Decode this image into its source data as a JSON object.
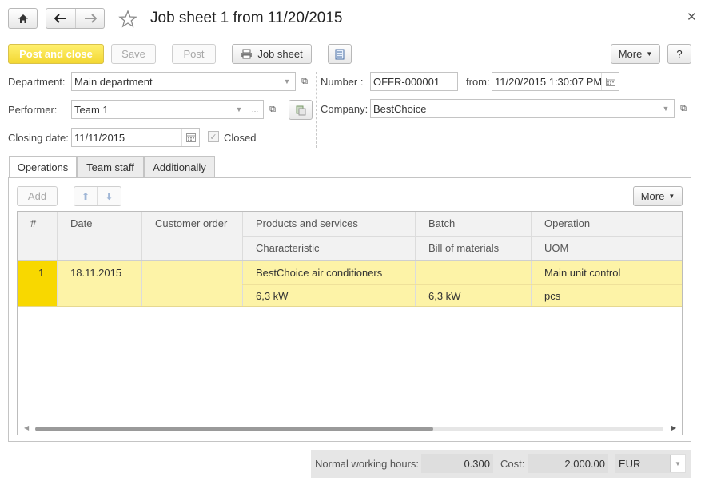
{
  "window": {
    "title": "Job sheet 1 from 11/20/2015"
  },
  "toolbar": {
    "post_close": "Post and close",
    "save": "Save",
    "post": "Post",
    "job_sheet": "Job sheet",
    "more": "More",
    "help": "?"
  },
  "form": {
    "department_label": "Department:",
    "department_value": "Main department",
    "performer_label": "Performer:",
    "performer_value": "Team 1",
    "closing_date_label": "Closing date:",
    "closing_date_value": "11/11/2015",
    "closed_label": "Closed",
    "number_label": "Number :",
    "number_value": "OFFR-000001",
    "from_label": "from:",
    "from_value": "11/20/2015  1:30:07 PM",
    "company_label": "Company:",
    "company_value": "BestChoice"
  },
  "tabs": [
    "Operations",
    "Team staff",
    "Additionally"
  ],
  "table_toolbar": {
    "add": "Add",
    "more": "More"
  },
  "table": {
    "headers": {
      "num": "#",
      "date": "Date",
      "customer_order": "Customer order",
      "products": "Products and services",
      "characteristic": "Characteristic",
      "batch": "Batch",
      "bom": "Bill of materials",
      "operation": "Operation",
      "uom": "UOM"
    },
    "rows": [
      {
        "num": "1",
        "date": "18.11.2015",
        "customer_order": "",
        "product": "BestChoice air conditioners",
        "characteristic": "6,3 kW",
        "batch": "",
        "bom": "6,3 kW",
        "operation": "Main unit control",
        "uom": "pcs"
      }
    ]
  },
  "footer": {
    "hours_label": "Normal working hours:",
    "hours_value": "0.300",
    "cost_label": "Cost:",
    "cost_value": "2,000.00",
    "currency": "EUR"
  },
  "colors": {
    "accent_yellow": "#f3d732",
    "row_highlight": "#fdf3a7",
    "row_num_cell": "#f8d800"
  },
  "icons": [
    "home-icon",
    "back-arrow-icon",
    "forward-arrow-icon",
    "star-icon",
    "close-icon",
    "printer-icon",
    "report-icon",
    "calendar-icon",
    "open-icon",
    "arrow-up-icon",
    "arrow-down-icon"
  ]
}
